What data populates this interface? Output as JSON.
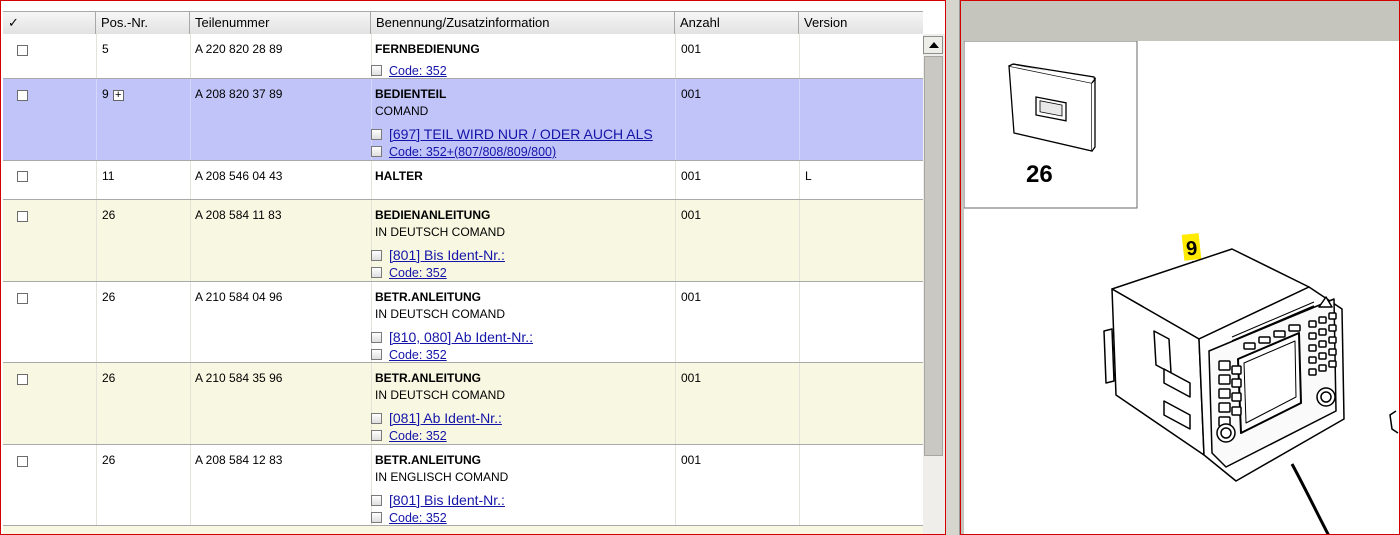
{
  "columns": {
    "check": "✓",
    "pos": "Pos.-Nr.",
    "part": "Teilenummer",
    "name": "Benennung/Zusatzinformation",
    "qty": "Anzahl",
    "version": "Version"
  },
  "colors": {
    "selected_row": "#c0c4f9",
    "yellow_row": "#f8f8e2",
    "white_row": "#ffffff",
    "link": "#1414a8",
    "callout_yellow": "#ffea00"
  },
  "rows": [
    {
      "pos": "5",
      "part": "A 220 820 28 89",
      "name": "FERNBEDIENUNG",
      "sub": "",
      "qty": "001",
      "version": "",
      "links": [
        "Code: 352"
      ]
    },
    {
      "pos": "9",
      "part": "A 208 820 37 89",
      "name": "BEDIENTEIL",
      "sub": "COMAND",
      "qty": "001",
      "version": "",
      "links": [
        "[697] TEIL WIRD NUR / ODER AUCH ALS",
        "Code: 352+(807/808/809/800)"
      ]
    },
    {
      "pos": "11",
      "part": "A 208 546 04 43",
      "name": "HALTER",
      "sub": "",
      "qty": "001",
      "version": "L",
      "links": []
    },
    {
      "pos": "26",
      "part": "A 208 584 11 83",
      "name": "BEDIENANLEITUNG",
      "sub": "IN DEUTSCH COMAND",
      "qty": "001",
      "version": "",
      "links": [
        "[801] Bis Ident-Nr.:",
        "Code: 352"
      ]
    },
    {
      "pos": "26",
      "part": "A 210 584 04 96",
      "name": "BETR.ANLEITUNG",
      "sub": "IN DEUTSCH COMAND",
      "qty": "001",
      "version": "",
      "links": [
        "[810, 080] Ab Ident-Nr.:",
        "Code: 352"
      ]
    },
    {
      "pos": "26",
      "part": "A 210 584 35 96",
      "name": "BETR.ANLEITUNG",
      "sub": "IN DEUTSCH COMAND",
      "qty": "001",
      "version": "",
      "links": [
        "[081] Ab Ident-Nr.:",
        "Code: 352"
      ]
    },
    {
      "pos": "26",
      "part": "A 208 584 12 83",
      "name": "BETR.ANLEITUNG",
      "sub": "IN ENGLISCH COMAND",
      "qty": "001",
      "version": "",
      "links": [
        "[801] Bis Ident-Nr.:",
        "Code: 352"
      ]
    }
  ],
  "drawing": {
    "inset_label": "26",
    "callout": "9"
  }
}
